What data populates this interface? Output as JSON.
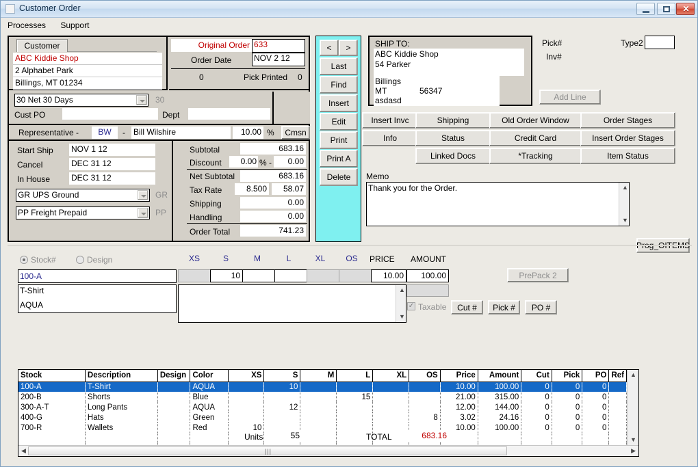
{
  "window": {
    "title": "Customer Order",
    "minimize_label": "─",
    "maximize_label": "□",
    "close_label": "✕"
  },
  "menu": {
    "items": [
      "Processes",
      "Support"
    ]
  },
  "customer": {
    "tab_label": "Customer",
    "name": "ABC Kiddie Shop",
    "address": "2 Alphabet Park",
    "city_state_zip": "Billings, MT 01234"
  },
  "order_header": {
    "original_order_label": "Original Order",
    "original_order_value": "633",
    "order_date_label": "Order Date",
    "order_date_value": "NOV 2 12",
    "left_count": "0",
    "pick_printed_label": "Pick Printed",
    "pick_printed_value": "0"
  },
  "terms": {
    "terms_value": "30   Net 30 Days",
    "terms_code": "30",
    "cust_po_label": "Cust PO",
    "cust_po_value": "",
    "dept_label": "Dept",
    "dept_value": ""
  },
  "representative": {
    "label": "Representative -",
    "dash": "-",
    "code": "BW",
    "name": "Bill Wilshire",
    "commission_pct": "10.00",
    "percent_sign": "%",
    "cmsn_button": "Cmsn"
  },
  "dates": {
    "start_ship_label": "Start Ship",
    "start_ship_value": "NOV 1 12",
    "cancel_label": "Cancel",
    "cancel_value": "DEC 31 12",
    "in_house_label": "In House",
    "in_house_value": "DEC 31 12",
    "ship_via_value": "GR   UPS Ground",
    "ship_via_code": "GR",
    "freight_value": "PP   Freight Prepaid",
    "freight_code": "PP"
  },
  "totals": {
    "subtotal_label": "Subtotal",
    "subtotal_value": "683.16",
    "discount_label": "Discount",
    "discount_pct": "0.00",
    "discount_pct_sign": "% -",
    "discount_value": "0.00",
    "net_subtotal_label": "Net Subtotal",
    "net_subtotal_value": "683.16",
    "tax_rate_label": "Tax Rate",
    "tax_rate_pct": "8.500",
    "tax_rate_value": "58.07",
    "shipping_label": "Shipping",
    "shipping_value": "0.00",
    "handling_label": "Handling",
    "handling_value": "0.00",
    "order_total_label": "Order Total",
    "order_total_value": "741.23"
  },
  "navigation": {
    "prev": "<",
    "next": ">",
    "buttons": [
      "Last",
      "Find",
      "Insert",
      "Edit",
      "Print",
      "Print A",
      "Delete"
    ]
  },
  "ship_to": {
    "header": "SHIP TO:",
    "name": "ABC Kiddie Shop",
    "address": "54 Parker",
    "blank": "",
    "city": "Billings",
    "state": "MT",
    "zip": "56347",
    "extra": "asdasd"
  },
  "order_meta": {
    "pick_label": "Pick#",
    "pick_value": "",
    "inv_label": "Inv#",
    "inv_value": "",
    "type2_label": "Type2",
    "type2_value": "",
    "add_line_button": "Add Line"
  },
  "action_buttons": {
    "row1": [
      "Insert Invc",
      "Shipping",
      "Old Order Window",
      "Order Stages"
    ],
    "row2": [
      "Info",
      "Status",
      "Credit Card",
      "Insert Order Stages"
    ],
    "row3": [
      "Linked Docs",
      "*Tracking",
      "Item Status"
    ]
  },
  "memo": {
    "label": "Memo",
    "text": "Thank you for the Order.",
    "prog_button": "Prog_OITEMS"
  },
  "item_entry": {
    "stock_radio_label": "Stock#",
    "design_radio_label": "Design",
    "stock_value": "100-A",
    "description_value": "T-Shirt",
    "color_value": "AQUA",
    "note_value": "",
    "size_headers": [
      "XS",
      "S",
      "M",
      "L",
      "XL",
      "OS"
    ],
    "size_values": [
      "",
      "10",
      "",
      "",
      "",
      ""
    ],
    "size_enabled": [
      false,
      true,
      true,
      true,
      false,
      false
    ],
    "price_label": "PRICE",
    "price_value": "10.00",
    "amount_label": "AMOUNT",
    "amount_value": "100.00",
    "extra_value": "",
    "taxable_label": "Taxable",
    "taxable_checked": true,
    "prepack_button": "PrePack 2",
    "cut_button": "Cut #",
    "pick_button": "Pick #",
    "po_button": "PO #"
  },
  "grid": {
    "columns": [
      "Stock",
      "Description",
      "Design",
      "Color",
      "XS",
      "S",
      "M",
      "L",
      "XL",
      "OS",
      "Price",
      "Amount",
      "Cut",
      "Pick",
      "PO",
      "Ref"
    ],
    "rows": [
      {
        "stock": "100-A",
        "description": "T-Shirt",
        "design": "",
        "color": "AQUA",
        "xs": "",
        "s": "10",
        "m": "",
        "l": "",
        "xl": "",
        "os": "",
        "price": "10.00",
        "amount": "100.00",
        "cut": "0",
        "pick": "0",
        "po": "0",
        "ref": "",
        "selected": true
      },
      {
        "stock": "200-B",
        "description": "Shorts",
        "design": "",
        "color": "Blue",
        "xs": "",
        "s": "",
        "m": "",
        "l": "15",
        "xl": "",
        "os": "",
        "price": "21.00",
        "amount": "315.00",
        "cut": "0",
        "pick": "0",
        "po": "0",
        "ref": "",
        "selected": false
      },
      {
        "stock": "300-A-T",
        "description": "Long Pants",
        "design": "",
        "color": "AQUA",
        "xs": "",
        "s": "12",
        "m": "",
        "l": "",
        "xl": "",
        "os": "",
        "price": "12.00",
        "amount": "144.00",
        "cut": "0",
        "pick": "0",
        "po": "0",
        "ref": "",
        "selected": false
      },
      {
        "stock": "400-G",
        "description": "Hats",
        "design": "",
        "color": "Green",
        "xs": "",
        "s": "",
        "m": "",
        "l": "",
        "xl": "",
        "os": "8",
        "price": "3.02",
        "amount": "24.16",
        "cut": "0",
        "pick": "0",
        "po": "0",
        "ref": "",
        "selected": false
      },
      {
        "stock": "700-R",
        "description": "Wallets",
        "design": "",
        "color": "Red",
        "xs": "10",
        "s": "",
        "m": "",
        "l": "",
        "xl": "",
        "os": "",
        "price": "10.00",
        "amount": "100.00",
        "cut": "0",
        "pick": "0",
        "po": "0",
        "ref": "",
        "selected": false
      }
    ]
  },
  "footer": {
    "units_label": "Units",
    "units_value": "55",
    "total_label": "TOTAL",
    "total_value": "683.16"
  },
  "colors": {
    "accent_cyan": "#7ff0f0",
    "selection_blue": "#1569c7",
    "red_text": "#c00000",
    "blue_text": "#2b2b8f",
    "face": "#d4d0c8"
  }
}
